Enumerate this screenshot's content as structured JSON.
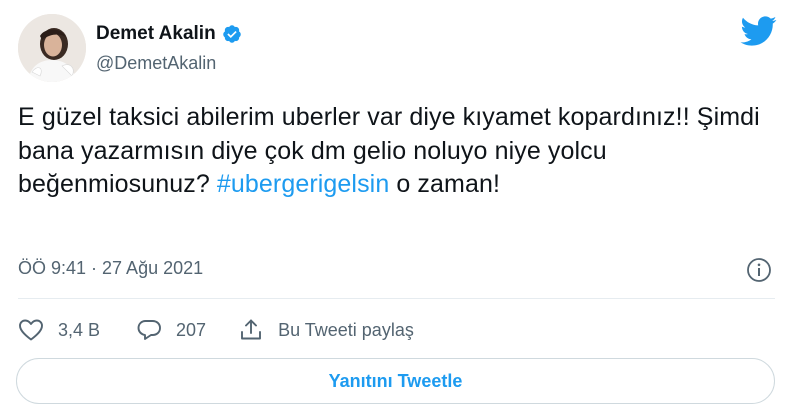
{
  "author": {
    "display_name": "Demet Akalin",
    "handle": "@DemetAkalin",
    "verified": true,
    "avatar_icon": "profile-photo"
  },
  "tweet": {
    "text_before": "E güzel taksici abilerim uberler var diye kıyamet kopardınız!! Şimdi bana yazarmısın diye çok dm gelio noluyo niye yolcu beğenmiosunuz? ",
    "hashtag": "#ubergerigelsin",
    "text_after": " o zaman!"
  },
  "meta": {
    "timestamp": "ÖÖ 9:41 · 27 Ağu 2021"
  },
  "actions": {
    "like_count": "3,4 B",
    "reply_count": "207",
    "share_label": "Bu Tweeti paylaş"
  },
  "reply_button": {
    "label": "Yanıtını Tweetle"
  },
  "colors": {
    "accent": "#1d9bf0",
    "text": "#0f1419",
    "secondary": "#536471",
    "border": "#cfd9de"
  }
}
